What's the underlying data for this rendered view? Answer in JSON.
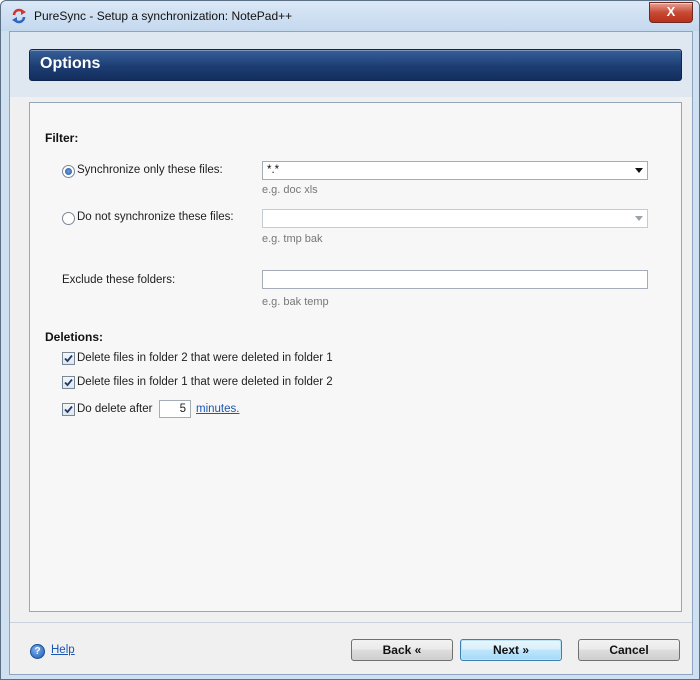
{
  "window": {
    "title": "PureSync - Setup a synchronization: NotePad++",
    "close_glyph": "X"
  },
  "header": {
    "title": "Options"
  },
  "filter": {
    "heading": "Filter:",
    "sync_only_label": "Synchronize only these files:",
    "sync_only_value": "*.*",
    "sync_only_hint": "e.g. doc xls",
    "sync_only_checked": true,
    "no_sync_label": "Do not synchronize these files:",
    "no_sync_value": "",
    "no_sync_hint": "e.g. tmp bak",
    "no_sync_checked": false,
    "exclude_label": "Exclude these folders:",
    "exclude_value": "",
    "exclude_hint": "e.g. bak temp"
  },
  "deletions": {
    "heading": "Deletions:",
    "delete_2_label": "Delete files in folder 2 that were deleted in folder 1",
    "delete_2_checked": true,
    "delete_1_label": "Delete files in folder 1 that were deleted in folder 2",
    "delete_1_checked": true,
    "delay_label": "Do delete after",
    "delay_checked": true,
    "delay_value": "5",
    "delay_unit_link": "minutes."
  },
  "footer": {
    "help_label": "Help",
    "back_label": "Back «",
    "next_label": "Next »",
    "cancel_label": "Cancel"
  },
  "colors": {
    "banner": "#1d3d72",
    "link": "#1a56b3",
    "close": "#c84a33"
  }
}
